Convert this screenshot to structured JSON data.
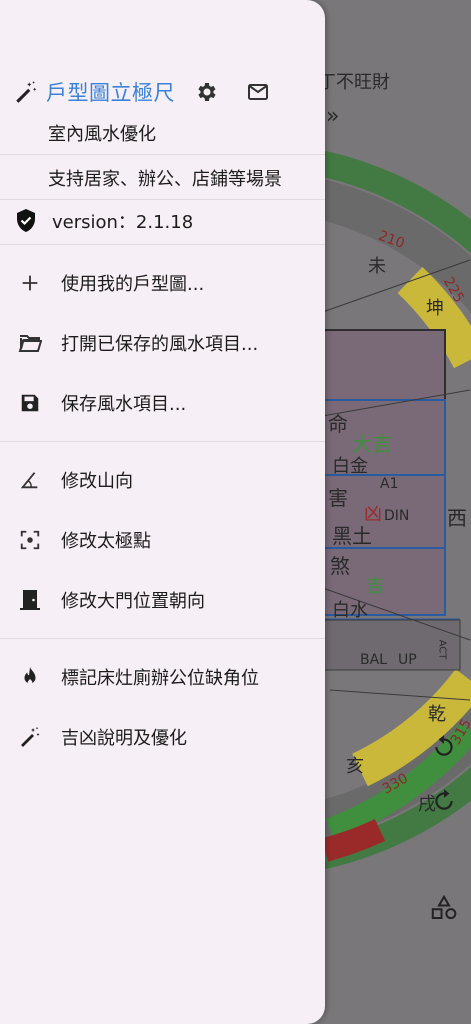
{
  "drawer": {
    "title": "戶型圖立極尺",
    "subtitle1": "室內風水優化",
    "subtitle2": "支持居家、辦公、店鋪等場景",
    "version": "version：2.1.18",
    "menu": [
      {
        "label": "使用我的戶型圖...",
        "icon": "plus-icon"
      },
      {
        "label": "打開已保存的風水項目...",
        "icon": "folder-open-icon"
      },
      {
        "label": "保存風水項目...",
        "icon": "save-icon"
      },
      {
        "label": "修改山向",
        "icon": "angle-icon"
      },
      {
        "label": "修改太極點",
        "icon": "center-focus-icon"
      },
      {
        "label": "修改大門位置朝向",
        "icon": "door-icon"
      },
      {
        "label": "標記床灶廁辦公位缺角位",
        "icon": "fire-icon"
      },
      {
        "label": "吉凶說明及優化",
        "icon": "magic-wand-icon"
      }
    ]
  },
  "background": {
    "top_text": "丁不旺財",
    "compass_numbers": [
      "210",
      "225",
      "330",
      "315"
    ],
    "compass_chars": [
      "未",
      "坤",
      "西",
      "乾",
      "亥",
      "戌"
    ],
    "palace_labels": [
      "命",
      "大吉",
      "白金",
      "害",
      "A1",
      "黑土",
      "凶",
      "DIN",
      "煞",
      "吉",
      "白水"
    ],
    "room_labels": [
      "BAL",
      "UP",
      "ACT"
    ]
  },
  "colors": {
    "accent_blue": "#3b82d6",
    "drawer_bg": "#f6eff6",
    "ring_yellow": "#c9b83a",
    "ring_green": "#3f8f3f",
    "ring_red": "#9a2a2a"
  }
}
